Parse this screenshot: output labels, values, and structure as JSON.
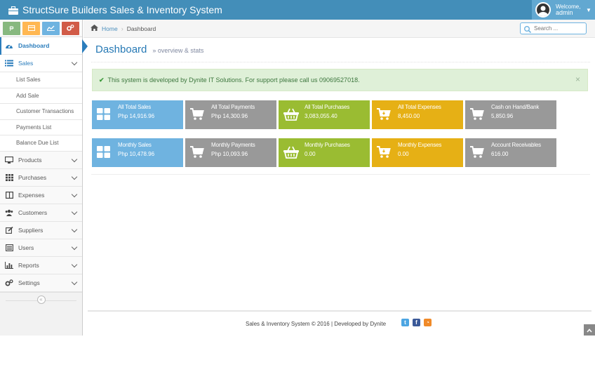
{
  "app": {
    "title": "StructSure Builders Sales & Inventory System",
    "welcome": "Welcome,",
    "username": "admin"
  },
  "shortcuts": [
    {
      "icon": "peso-icon",
      "glyph": "₱",
      "color": "#87b87f"
    },
    {
      "icon": "credit-card-icon",
      "glyph": "▭",
      "color": "#ffb752"
    },
    {
      "icon": "line-chart-icon",
      "glyph": "∿",
      "color": "#6fb3e0"
    },
    {
      "icon": "cogs-icon",
      "glyph": "✲",
      "color": "#d15b47"
    }
  ],
  "sidebar": {
    "items": [
      {
        "label": "Dashboard",
        "icon": "dashboard-icon"
      },
      {
        "label": "Sales",
        "icon": "list-icon"
      },
      {
        "label": "Products",
        "icon": "desktop-icon"
      },
      {
        "label": "Purchases",
        "icon": "grid-icon"
      },
      {
        "label": "Expenses",
        "icon": "columns-icon"
      },
      {
        "label": "Customers",
        "icon": "users-icon"
      },
      {
        "label": "Suppliers",
        "icon": "edit-icon"
      },
      {
        "label": "Users",
        "icon": "list-alt-icon"
      },
      {
        "label": "Reports",
        "icon": "bar-chart-icon"
      },
      {
        "label": "Settings",
        "icon": "cogs-icon"
      }
    ],
    "sales_sub": [
      "List Sales",
      "Add Sale",
      "Customer Transactions",
      "Payments List",
      "Balance Due List"
    ],
    "collapse_glyph": "«"
  },
  "breadcrumb": {
    "home": "Home",
    "current": "Dashboard"
  },
  "search": {
    "placeholder": "Search ..."
  },
  "page": {
    "title": "Dashboard",
    "subtitle": "» overview & stats"
  },
  "alert": {
    "text": "This system is developed by Dynite IT Solutions. For support please call us 09069527018.",
    "close": "×"
  },
  "tiles_row1": [
    {
      "label": "All Total Sales",
      "value": "Php 14,916.96",
      "icon": "th-large-icon",
      "color": "#6fb3e0"
    },
    {
      "label": "All Total Payments",
      "value": "Php 14,300.96",
      "icon": "shopping-cart-icon",
      "color": "#999999"
    },
    {
      "label": "All Total Purchases",
      "value": "3,083,055.40",
      "icon": "shopping-basket-icon",
      "color": "#9abc32"
    },
    {
      "label": "All Total Expenses",
      "value": "8,450.00",
      "icon": "cart-arrow-down-icon",
      "color": "#e6b015"
    },
    {
      "label": "Cash on Hand/Bank",
      "value": "5,850.96",
      "icon": "shopping-cart-icon",
      "color": "#999999"
    }
  ],
  "tiles_row2": [
    {
      "label": "Monthly Sales",
      "value": "Php 10,478.96",
      "icon": "th-large-icon",
      "color": "#6fb3e0"
    },
    {
      "label": "Monthly Payments",
      "value": "Php 10,093.96",
      "icon": "shopping-cart-icon",
      "color": "#999999"
    },
    {
      "label": "Monthly Purchases",
      "value": "0.00",
      "icon": "shopping-basket-icon",
      "color": "#9abc32"
    },
    {
      "label": "Monthly Expenses",
      "value": "0.00",
      "icon": "cart-arrow-down-icon",
      "color": "#e6b015"
    },
    {
      "label": "Account Receivables",
      "value": "616.00",
      "icon": "shopping-cart-icon",
      "color": "#999999"
    }
  ],
  "footer": {
    "text": "Sales & Inventory System © 2016 | Developed by Dynite",
    "social": [
      {
        "icon": "twitter-icon",
        "glyph": "t",
        "color": "#4ca5e2"
      },
      {
        "icon": "facebook-icon",
        "glyph": "f",
        "color": "#3b5998"
      },
      {
        "icon": "rss-icon",
        "glyph": "◔",
        "color": "#f08a28"
      }
    ]
  }
}
